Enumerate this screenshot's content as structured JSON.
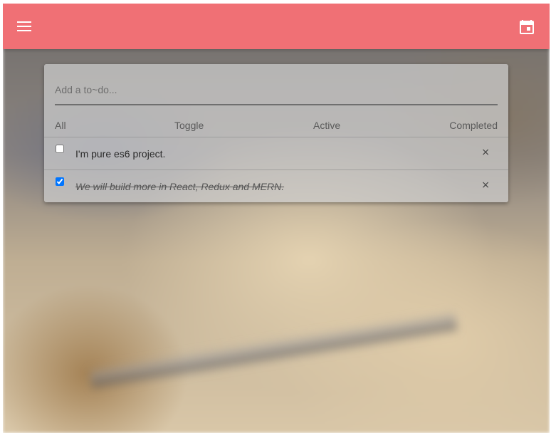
{
  "appbar": {
    "color": "#f07075",
    "menu_icon": "menu-icon",
    "calendar_icon": "calendar-icon"
  },
  "input": {
    "placeholder": "Add a to~do...",
    "value": ""
  },
  "filters": {
    "all": "All",
    "toggle": "Toggle",
    "active": "Active",
    "completed": "Completed"
  },
  "todos": [
    {
      "text": "I'm pure es6 project.",
      "completed": false,
      "delete_label": "×"
    },
    {
      "text": "We will build more in React, Redux and MERN.",
      "completed": true,
      "delete_label": "×"
    }
  ]
}
